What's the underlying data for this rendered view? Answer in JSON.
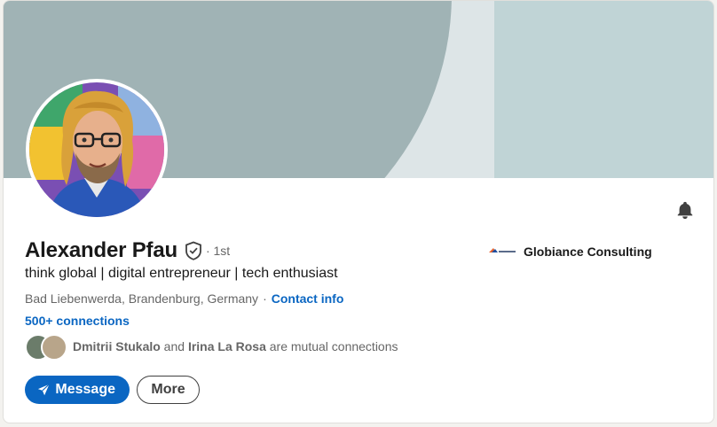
{
  "profile": {
    "name": "Alexander Pfau",
    "degree": "· 1st",
    "headline": "think global | digital entrepreneur | tech enthusiast",
    "location": "Bad Liebenwerda, Brandenburg, Germany",
    "separator": "·",
    "contact_info": "Contact info",
    "connections": "500+ connections",
    "mutual": {
      "person1": "Dmitrii Stukalo",
      "and": " and ",
      "person2": "Irina La Rosa",
      "suffix": " are mutual connections"
    }
  },
  "company": {
    "name": "Globiance Consulting"
  },
  "actions": {
    "message": "Message",
    "more": "More"
  },
  "icons": {
    "verified": "shield-check-icon",
    "bell": "bell-icon",
    "send": "paper-plane-icon"
  },
  "colors": {
    "accent": "#0a66c2",
    "banner_arc": "#a0b3b5",
    "banner_bg": "#dde5e7",
    "banner_right": "#c0d4d6"
  }
}
